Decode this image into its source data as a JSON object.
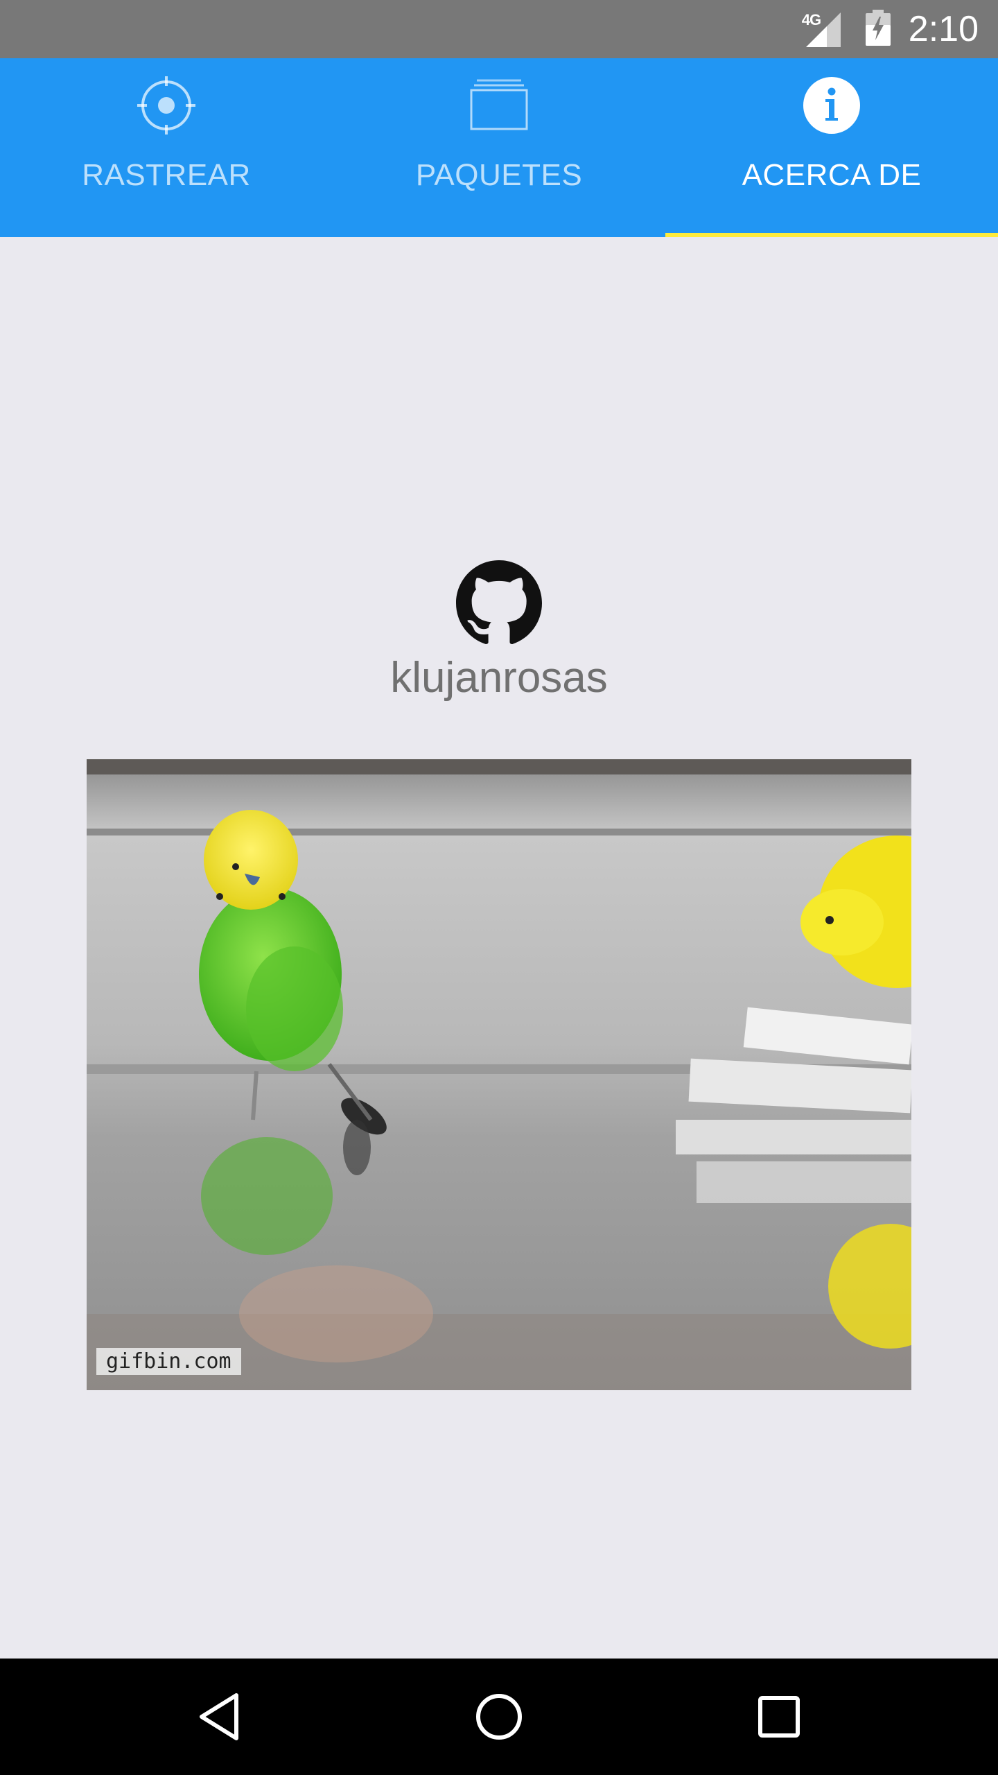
{
  "status_bar": {
    "network": "4G",
    "time": "2:10",
    "icons": [
      "signal-icon",
      "battery-icon"
    ]
  },
  "tabs": [
    {
      "label": "RASTREAR",
      "icon": "crosshair-icon",
      "active": false
    },
    {
      "label": "PAQUETES",
      "icon": "packages-icon",
      "active": false
    },
    {
      "label": "ACERCA DE",
      "icon": "info-icon",
      "active": true
    }
  ],
  "colors": {
    "app_bar": "#2196F3",
    "indicator": "#FFEB3B",
    "background": "#EAE9EF",
    "status_bar": "#787878"
  },
  "about": {
    "icon": "github-icon",
    "username": "klujanrosas",
    "gif_watermark": "gifbin.com"
  },
  "nav_bar": {
    "icons": [
      "back-icon",
      "home-icon",
      "recents-icon"
    ]
  }
}
